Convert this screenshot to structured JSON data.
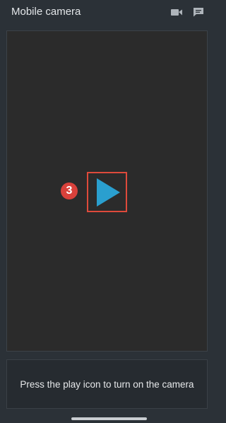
{
  "app": {
    "title": "Mobile camera"
  },
  "header": {
    "icons": [
      "video-camera-icon",
      "chat-icon"
    ]
  },
  "preview": {
    "play_icon": "play-icon",
    "step_number": "3"
  },
  "message": {
    "text": "Press the play icon to turn on the camera"
  },
  "colors": {
    "background": "#2b3137",
    "preview_background": "#2b2b2b",
    "play_accent": "#2a9fcf",
    "highlight_border": "#de4a3b",
    "step_badge": "#d9413b"
  }
}
